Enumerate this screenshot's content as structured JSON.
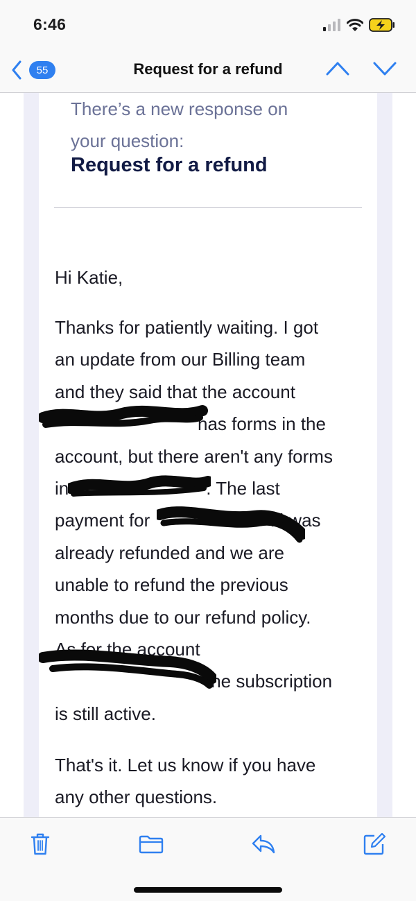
{
  "status_bar": {
    "time": "6:46",
    "icons": [
      "cellular-signal-icon",
      "wifi-icon",
      "battery-charging-icon"
    ],
    "battery_color": "#f5d21b"
  },
  "nav": {
    "back_badge": "55",
    "title": "Request for a refund",
    "icons": [
      "back-chevron-icon",
      "previous-message-icon",
      "next-message-icon"
    ],
    "accent_color": "#2f80f0"
  },
  "email": {
    "intro_line1": "There’s a new response on",
    "intro_line2": "your question:",
    "headline": "Request for a refund",
    "greeting": "Hi Katie,",
    "paragraph1_lines": [
      "Thanks for patiently waiting. I got",
      "an update from our Billing team",
      "and they said that the account",
      "has forms in the",
      "account, but there aren't any forms",
      "in",
      ". The last",
      "payment for",
      "ki was",
      "already refunded and we are",
      "unable to refund the previous",
      "months due to our refund policy.",
      "As for the account",
      "the subscription",
      "is still active."
    ],
    "paragraph2_lines": [
      "That's it. Let us know if you have",
      "any other questions."
    ]
  },
  "toolbar": {
    "icons": [
      "trash-icon",
      "folder-icon",
      "reply-icon",
      "compose-icon"
    ],
    "icon_color": "#2f80f0"
  }
}
